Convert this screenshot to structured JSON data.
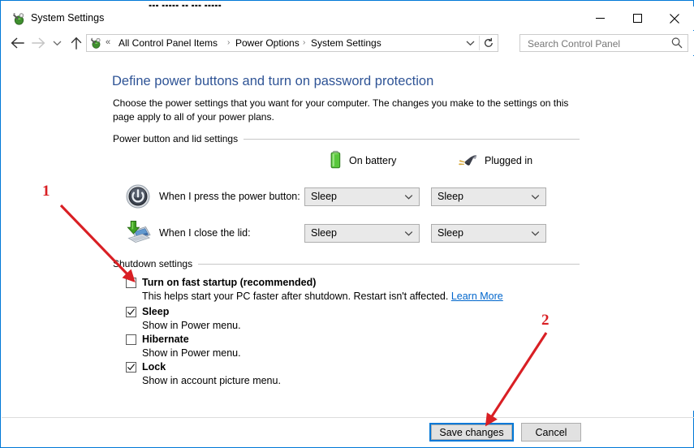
{
  "window": {
    "title": "System Settings",
    "title_icon": "system-settings-icon",
    "bg_window_sliver_text": "▪▪▪ ▪▪▪▪▪ ▪▪ ▪▪▪ ▪▪▪▪▪",
    "controls": {
      "minimize": "Minimize",
      "maximize": "Maximize",
      "close": "Close"
    }
  },
  "nav": {
    "back": "Back",
    "forward": "Forward",
    "recent": "Recent locations",
    "up": "Up one level",
    "breadcrumb_overflow": "«",
    "breadcrumbs": [
      {
        "label": "All Control Panel Items"
      },
      {
        "label": "Power Options"
      },
      {
        "label": "System Settings"
      }
    ],
    "separator": "›",
    "dropdown": "Previous locations",
    "refresh": "Refresh"
  },
  "search": {
    "placeholder": "Search Control Panel",
    "value": "",
    "icon": "search-icon"
  },
  "page": {
    "title": "Define power buttons and turn on password protection",
    "description": "Choose the power settings that you want for your computer. The changes you make to the settings on this page apply to all of your power plans."
  },
  "power_section": {
    "header": "Power button and lid settings",
    "columns": [
      {
        "label": "On battery",
        "icon": "battery-icon"
      },
      {
        "label": "Plugged in",
        "icon": "power-plug-icon"
      }
    ],
    "rows": [
      {
        "icon": "power-button-icon",
        "label": "When I press the power button:",
        "on_battery": "Sleep",
        "plugged_in": "Sleep"
      },
      {
        "icon": "laptop-close-lid-icon",
        "label": "When I close the lid:",
        "on_battery": "Sleep",
        "plugged_in": "Sleep"
      }
    ]
  },
  "shutdown_section": {
    "header": "Shutdown settings",
    "items": [
      {
        "label": "Turn on fast startup (recommended)",
        "checked": false,
        "description": "This helps start your PC faster after shutdown. Restart isn't affected.",
        "link": "Learn More"
      },
      {
        "label": "Sleep",
        "checked": true,
        "description": "Show in Power menu.",
        "link": ""
      },
      {
        "label": "Hibernate",
        "checked": false,
        "description": "Show in Power menu.",
        "link": ""
      },
      {
        "label": "Lock",
        "checked": true,
        "description": "Show in account picture menu.",
        "link": ""
      }
    ]
  },
  "footer": {
    "save_label": "Save changes",
    "cancel_label": "Cancel"
  },
  "annotations": {
    "accent_color": "#d91f24",
    "markers": [
      {
        "number": "1",
        "points_to": "Turn on fast startup (recommended) checkbox"
      },
      {
        "number": "2",
        "points_to": "Save changes button"
      }
    ]
  }
}
